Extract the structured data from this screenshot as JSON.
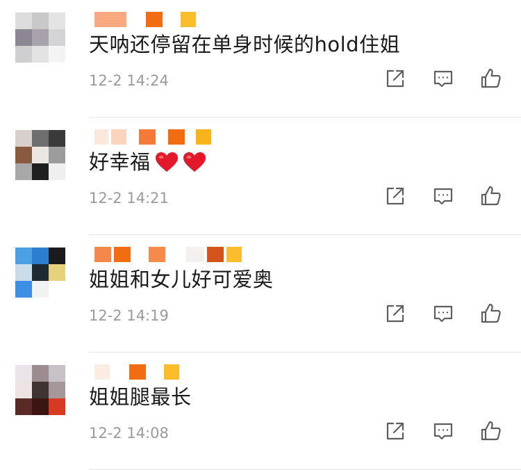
{
  "comments": [
    {
      "text": "天呐还停留在单身时候的hold住姐",
      "time": "12-2 14:24",
      "emoji": [],
      "avatar": [
        "#dcdcdc",
        "#c9c9c9",
        "#e4e4e4",
        "#8d8793",
        "#a7a2ab",
        "#d4d3d6",
        "#cfcfd2",
        "#e3e3e3",
        "#f4f4f4"
      ],
      "name_blocks": [
        {
          "color": "#f9a87f",
          "w": 46
        },
        {
          "color": "#ffffff",
          "w": 20
        },
        {
          "color": "#f26d12",
          "w": 24
        },
        {
          "color": "#ffffff",
          "w": 18
        },
        {
          "color": "#fbbd2c",
          "w": 22
        }
      ]
    },
    {
      "text": "好幸福",
      "time": "12-2 14:21",
      "emoji": [
        "heart",
        "heart"
      ],
      "avatar": [
        "#d8d0cc",
        "#6e6e6e",
        "#3a3a3a",
        "#8a5a40",
        "#ece6e2",
        "#9c9c9c",
        "#a8a8a8",
        "#1f1f1f",
        "#efefef"
      ],
      "name_blocks": [
        {
          "color": "#fbe7dc",
          "w": 20
        },
        {
          "color": "#fcd3bd",
          "w": 22
        },
        {
          "color": "#ffffff",
          "w": 10
        },
        {
          "color": "#f57a3a",
          "w": 24
        },
        {
          "color": "#ffffff",
          "w": 10
        },
        {
          "color": "#f26d12",
          "w": 24
        },
        {
          "color": "#ffffff",
          "w": 8
        },
        {
          "color": "#f8b41a",
          "w": 22
        }
      ]
    },
    {
      "text": "姐姐和女儿好可爱奥",
      "time": "12-2 14:19",
      "emoji": [],
      "avatar": [
        "#4aa0e0",
        "#2c7ed0",
        "#1b1b1b",
        "#c8dcec",
        "#1e2a33",
        "#e5d27a",
        "#3d8fe6",
        "#f2f2f2",
        "#ffffff"
      ],
      "name_blocks": [
        {
          "color": "#f4884a",
          "w": 24
        },
        {
          "color": "#f26d12",
          "w": 24
        },
        {
          "color": "#ffffff",
          "w": 18
        },
        {
          "color": "#f58a4a",
          "w": 24
        },
        {
          "color": "#ffffff",
          "w": 22
        },
        {
          "color": "#f4f0ee",
          "w": 26
        },
        {
          "color": "#d2541a",
          "w": 24
        },
        {
          "color": "#fbbd2c",
          "w": 22
        }
      ]
    },
    {
      "text": "姐姐腿最长",
      "time": "12-2 14:08",
      "emoji": [],
      "avatar": [
        "#e8e4ea",
        "#9c8c90",
        "#c7c2c8",
        "#ebe4e3",
        "#403433",
        "#a49699",
        "#5a2a24",
        "#3b1511",
        "#d63a22"
      ],
      "name_blocks": [
        {
          "color": "#fdece1",
          "w": 22
        },
        {
          "color": "#ffffff",
          "w": 20
        },
        {
          "color": "#f26d12",
          "w": 24
        },
        {
          "color": "#ffffff",
          "w": 18
        },
        {
          "color": "#fbbd2c",
          "w": 22
        }
      ]
    }
  ],
  "actions": [
    "share-icon",
    "comment-icon",
    "like-icon"
  ],
  "colors": {
    "text": "#1a1a1a",
    "meta": "#9a9a9a",
    "icon": "#5e5e5e",
    "heart": "#e4182b",
    "divider": "#e6e6e6"
  }
}
